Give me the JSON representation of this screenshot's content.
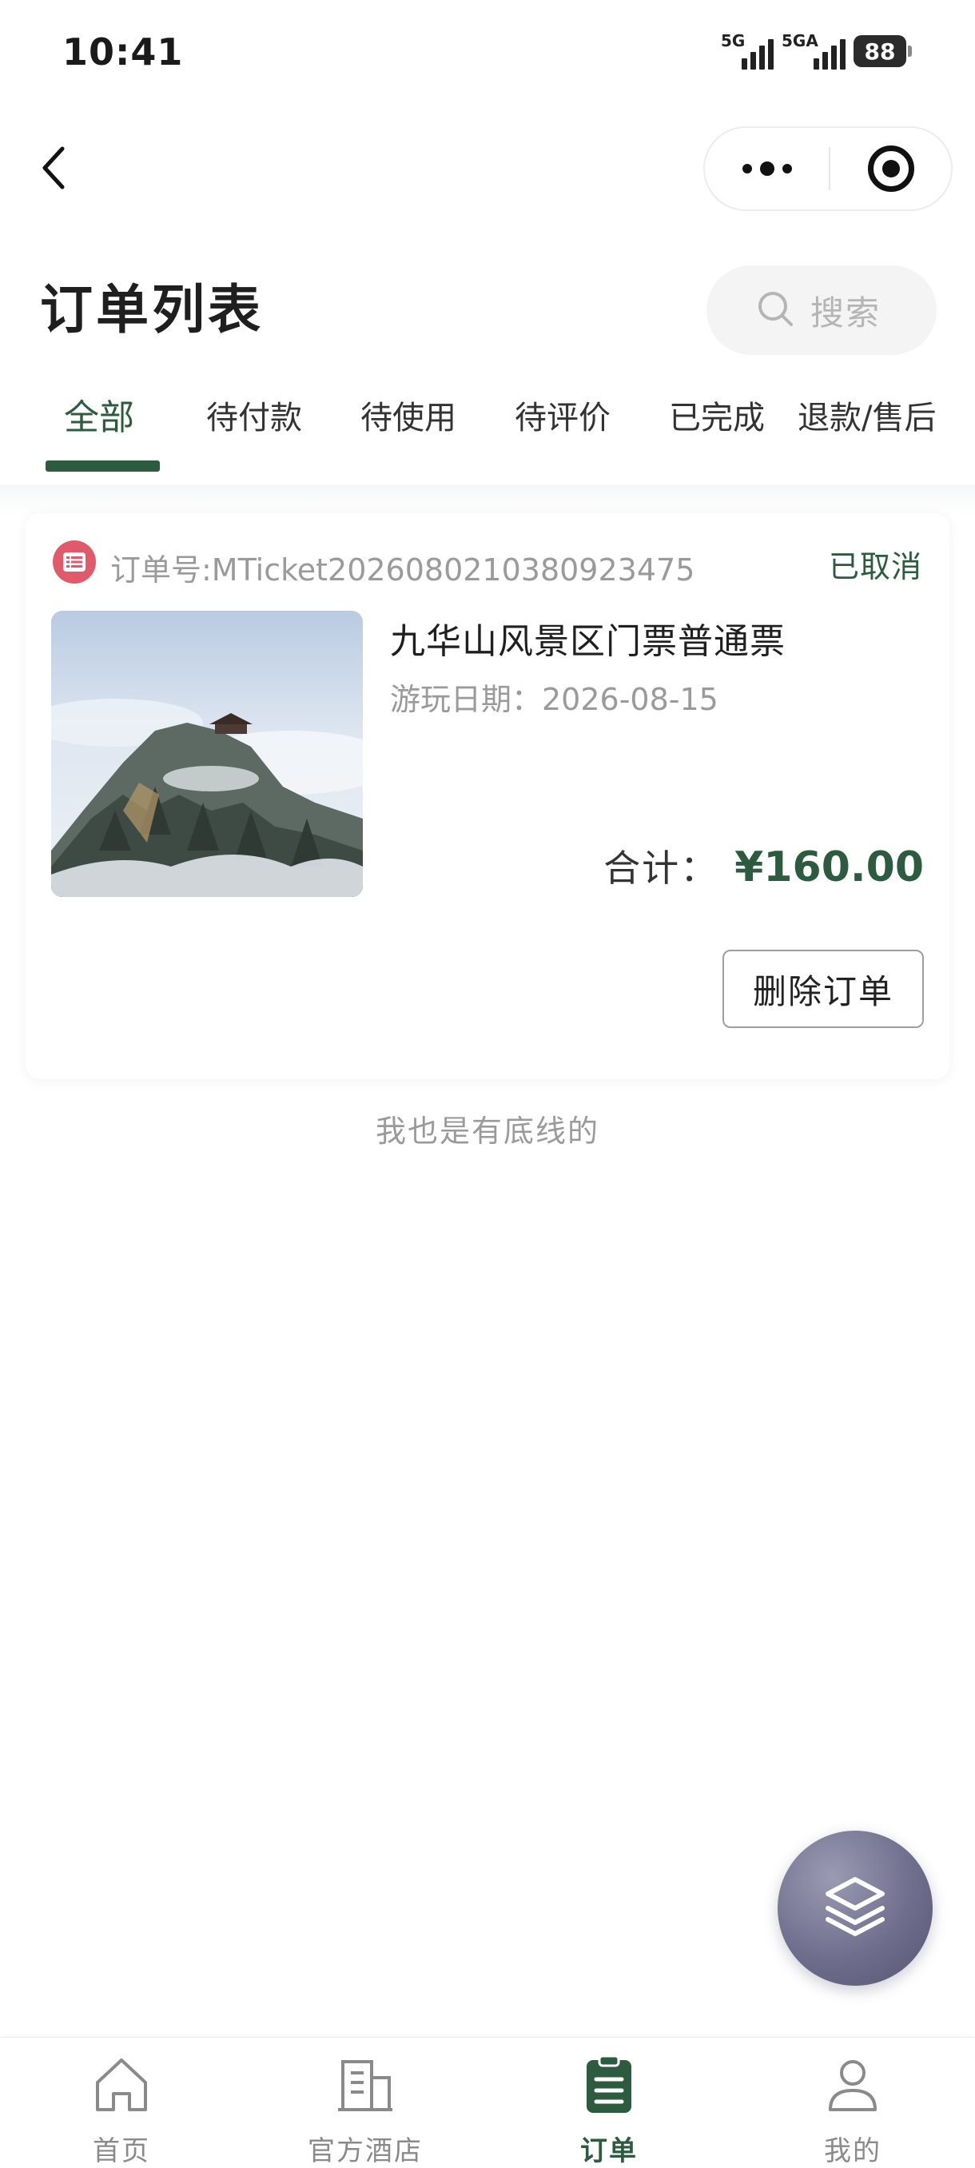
{
  "status_bar": {
    "time": "10:41",
    "signal_1_label": "5G",
    "signal_2_label": "5GA",
    "battery": "88"
  },
  "nav": {
    "back_icon": "chevron-left-icon",
    "more_icon": "more-dots-icon",
    "close_icon": "target-circle-icon"
  },
  "header": {
    "title": "订单列表",
    "search_placeholder": "搜索"
  },
  "tabs": [
    {
      "label": "全部",
      "active": true
    },
    {
      "label": "待付款",
      "active": false
    },
    {
      "label": "待使用",
      "active": false
    },
    {
      "label": "待评价",
      "active": false
    },
    {
      "label": "已完成",
      "active": false
    },
    {
      "label": "退款/售后",
      "active": false
    }
  ],
  "order": {
    "order_number": "订单号:MTicket202608021038092347​5",
    "status": "已取消",
    "ticket_name": "九华山风景区门票普通票",
    "visit_date": "游玩日期：2026-08-15",
    "total_label": "合计：",
    "total_amount": "¥160.00",
    "delete_label": "删除订单"
  },
  "footer_text": "我也是有底线的",
  "tab_bar": [
    {
      "label": "首页",
      "icon": "home-icon",
      "active": false
    },
    {
      "label": "官方酒店",
      "icon": "building-icon",
      "active": false
    },
    {
      "label": "订单",
      "icon": "clipboard-list-icon",
      "active": true
    },
    {
      "label": "我的",
      "icon": "user-icon",
      "active": false
    }
  ],
  "colors": {
    "accent": "#2d5b3f",
    "order_icon": "#e05a6c",
    "fab": "#6f6e8d"
  }
}
